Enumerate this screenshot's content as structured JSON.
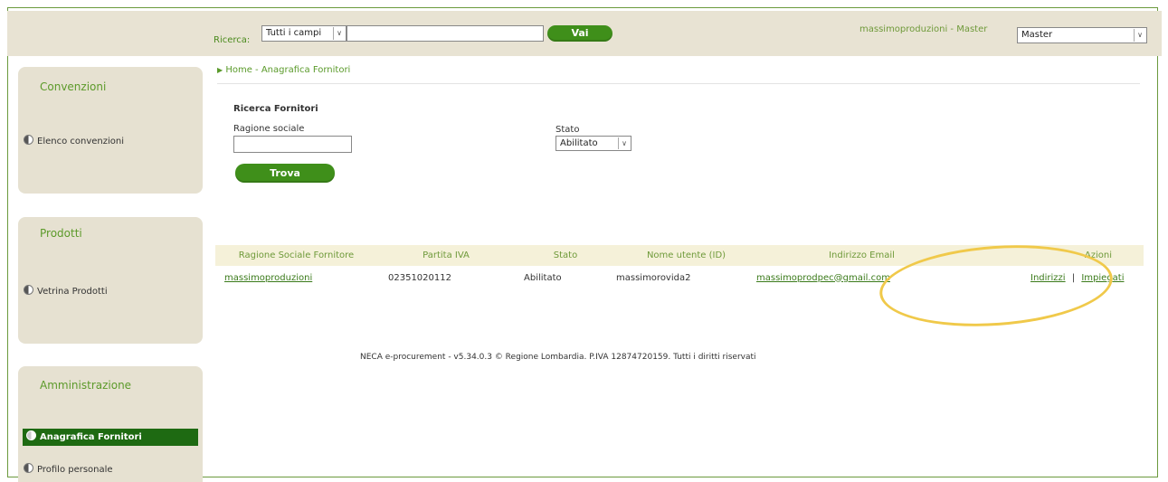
{
  "topbar": {
    "search_label": "Ricerca:",
    "search_scope": "Tutti i campi",
    "search_value": "",
    "go_label": "Vai",
    "user_text": "massimoproduzioni - Master",
    "role_value": "Master"
  },
  "sidebar": {
    "sections": [
      {
        "title": "Convenzioni",
        "items": [
          "Elenco convenzioni"
        ]
      },
      {
        "title": "Prodotti",
        "items": [
          "Vetrina Prodotti"
        ]
      },
      {
        "title": "Amministrazione",
        "items": [
          "Anagrafica Fornitori",
          "Profilo personale"
        ]
      }
    ]
  },
  "breadcrumb": "Home - Anagrafica Fornitori",
  "search_form": {
    "title": "Ricerca Fornitori",
    "ragione_label": "Ragione sociale",
    "ragione_value": "",
    "stato_label": "Stato",
    "stato_value": "Abilitato",
    "find_label": "Trova"
  },
  "table": {
    "headers": [
      "Ragione Sociale Fornitore",
      "Partita IVA",
      "Stato",
      "Nome utente (ID)",
      "Indirizzo Email",
      "Azioni"
    ],
    "rows": [
      {
        "ragione": "massimoproduzioni",
        "piva": "02351020112",
        "stato": "Abilitato",
        "utente": "massimorovida2",
        "email": "massimoprodpec@gmail.com",
        "action1": "Indirizzi",
        "sep": "|",
        "action2": "Impiegati"
      }
    ]
  },
  "footer": "NECA e-procurement - v5.34.0.3 © Regione Lombardia. P.IVA 12874720159. Tutti i diritti riservati",
  "colors": {
    "accent": "#3f8f1a",
    "topbar": "#e8e3d3",
    "highlight": "#f0c94a"
  }
}
